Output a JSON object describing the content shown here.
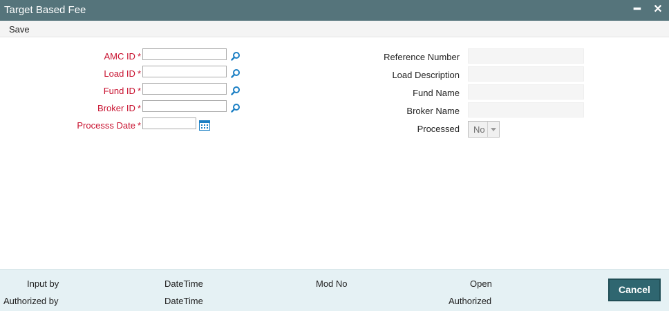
{
  "window": {
    "title": "Target Based Fee",
    "minimize_glyph": "━",
    "close_glyph": "✕"
  },
  "menu": {
    "save_label": "Save"
  },
  "form_left": {
    "amc_id_label": "AMC ID",
    "load_id_label": "Load ID",
    "fund_id_label": "Fund ID",
    "broker_id_label": "Broker ID",
    "process_date_label": "Processs Date",
    "required_mark": "*"
  },
  "form_right": {
    "reference_number_label": "Reference Number",
    "load_description_label": "Load Description",
    "fund_name_label": "Fund Name",
    "broker_name_label": "Broker Name",
    "processed_label": "Processed",
    "processed_value": "No"
  },
  "footer": {
    "input_by_label": "Input by",
    "authorized_by_label": "Authorized by",
    "datetime_label_1": "DateTime",
    "datetime_label_2": "DateTime",
    "mod_no_label": "Mod No",
    "open_label": "Open",
    "authorized_label": "Authorized",
    "cancel_label": "Cancel"
  },
  "icons": {
    "lookup": "magnifier-icon",
    "calendar": "calendar-icon",
    "dropdown": "chevron-down-icon"
  },
  "colors": {
    "titlebar": "#55747b",
    "required_label": "#c8102e",
    "footer_bg": "#e5f1f4",
    "cancel_button": "#2f6670",
    "icon_blue": "#1b7fc4"
  }
}
